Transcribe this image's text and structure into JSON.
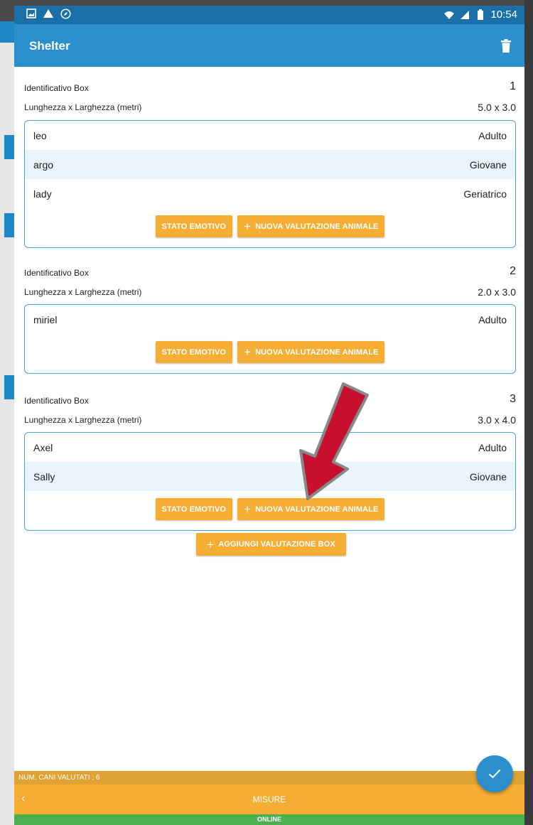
{
  "status_bar": {
    "time": "10:54"
  },
  "app_bar": {
    "title": "Shelter"
  },
  "labels": {
    "box_id": "Identificativo Box",
    "dimensions": "Lunghezza x Larghezza (metri)"
  },
  "boxes": [
    {
      "id": "1",
      "dimensions": "5.0 x 3.0",
      "animals": [
        {
          "name": "leo",
          "age": "Adulto"
        },
        {
          "name": "argo",
          "age": "Giovane"
        },
        {
          "name": "lady",
          "age": "Geriatrico"
        }
      ]
    },
    {
      "id": "2",
      "dimensions": "2.0 x 3.0",
      "animals": [
        {
          "name": "miriel",
          "age": "Adulto"
        }
      ]
    },
    {
      "id": "3",
      "dimensions": "3.0 x 4.0",
      "animals": [
        {
          "name": "Axel",
          "age": "Adulto"
        },
        {
          "name": "Sally",
          "age": "Giovane"
        }
      ]
    }
  ],
  "buttons": {
    "emotional_state": "STATO EMOTIVO",
    "new_animal_eval": "NUOVA VALUTAZIONE ANIMALE",
    "add_box_eval": "AGGIUNGI VALUTAZIONE BOX"
  },
  "footer": {
    "count_label": "NUM. CANI VALUTATI : 6",
    "nav_label": "MISURE",
    "online": "ONLINE"
  },
  "colors": {
    "primary": "#2a8fcc",
    "accent": "#f5ad33",
    "online": "#4caf50",
    "annotation_arrow": "#c8102e"
  }
}
